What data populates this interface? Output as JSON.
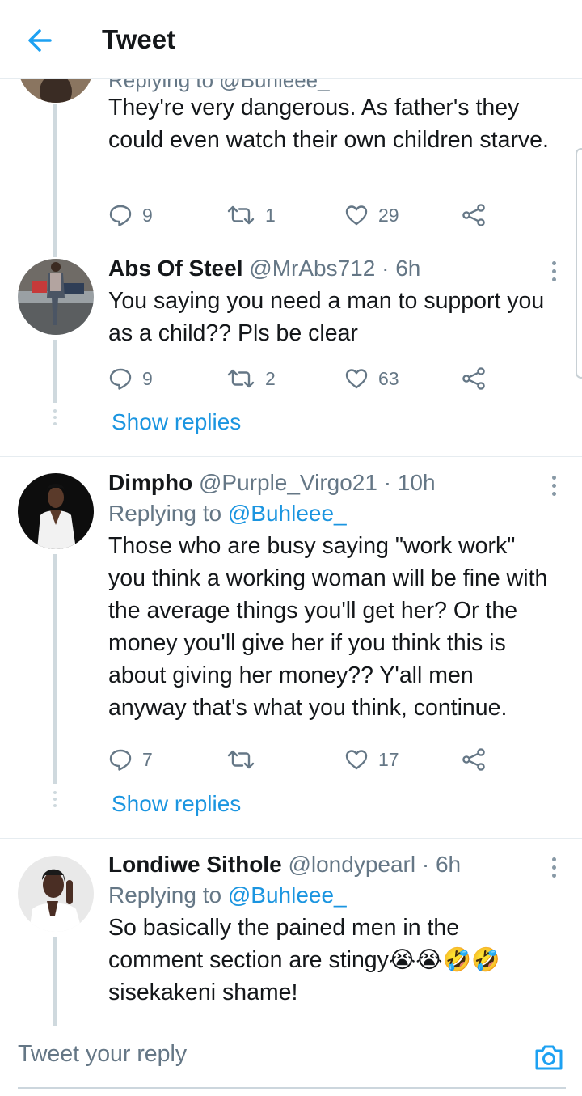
{
  "header": {
    "title": "Tweet"
  },
  "tweets": [
    {
      "reply_to_line": "Replying to @Buhleee_",
      "text": "They're very dangerous. As father's they could even watch their own children starve.",
      "actions": {
        "replies": "9",
        "retweets": "1",
        "likes": "29"
      }
    },
    {
      "name": "Abs Of Steel",
      "handle": "@MrAbs712",
      "time": "6h",
      "text": "You saying you need a man to support you as a child?? Pls be clear",
      "actions": {
        "replies": "9",
        "retweets": "2",
        "likes": "63"
      },
      "show_replies": "Show replies"
    },
    {
      "name": "Dimpho",
      "handle": "@Purple_Virgo21",
      "time": "10h",
      "replying_label": "Replying to",
      "replying_to": "@Buhleee_",
      "text": "Those who are busy saying \"work work\" you think a working woman will be fine with the average things you'll get her? Or the money you'll give her if you think this is about giving her money?? Y'all men anyway that's what you think, continue.",
      "actions": {
        "replies": "7",
        "retweets": "",
        "likes": "17"
      },
      "show_replies": "Show replies"
    },
    {
      "name": "Londiwe Sithole",
      "handle": "@londypearl",
      "time": "6h",
      "replying_label": "Replying to",
      "replying_to": "@Buhleee_",
      "text_line1": "So basically the pained men in the",
      "text_line2": "comment section are stingy",
      "text_emoji": "😭😭🤣🤣",
      "text_line3": "sisekakeni shame!"
    }
  ],
  "composer": {
    "placeholder": "Tweet your reply"
  },
  "icons": [
    "back-arrow-icon",
    "reply-icon",
    "retweet-icon",
    "like-icon",
    "share-icon",
    "more-icon",
    "camera-icon"
  ],
  "colors": {
    "accent": "#1b95e0",
    "text": "#14171a",
    "secondary": "#657786",
    "divider": "#e6ecf0"
  }
}
